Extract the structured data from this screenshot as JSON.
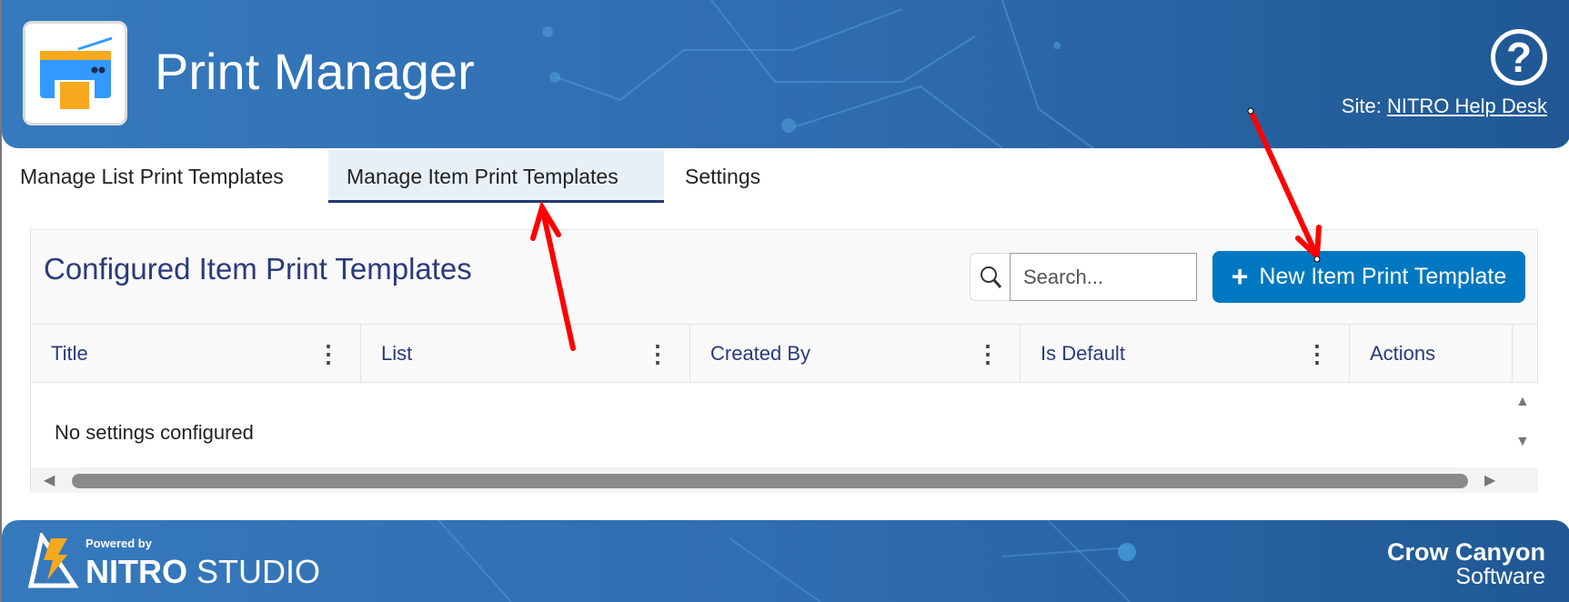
{
  "header": {
    "title": "Print Manager",
    "site_label": "Site:",
    "site_link": "NITRO Help Desk",
    "help_icon": "question-circle-icon",
    "logo_icon": "printer-icon"
  },
  "tabs": [
    {
      "label": "Manage List Print Templates",
      "active": false
    },
    {
      "label": "Manage Item Print Templates",
      "active": true
    },
    {
      "label": "Settings",
      "active": false
    }
  ],
  "panel": {
    "title": "Configured Item Print Templates",
    "search_placeholder": "Search...",
    "search_value": "",
    "new_button": "New Item Print Template",
    "columns": [
      "Title",
      "List",
      "Created By",
      "Is Default",
      "Actions"
    ],
    "empty_message": "No settings configured"
  },
  "footer": {
    "powered_by": "Powered by",
    "nitro": "NITRO",
    "studio": "STUDIO",
    "crow": "Crow Canyon",
    "software": "Software"
  },
  "colors": {
    "header": "#2e6cae",
    "accent": "#0078c1",
    "title": "#2b3a7a",
    "annotation": "#ff0000"
  }
}
